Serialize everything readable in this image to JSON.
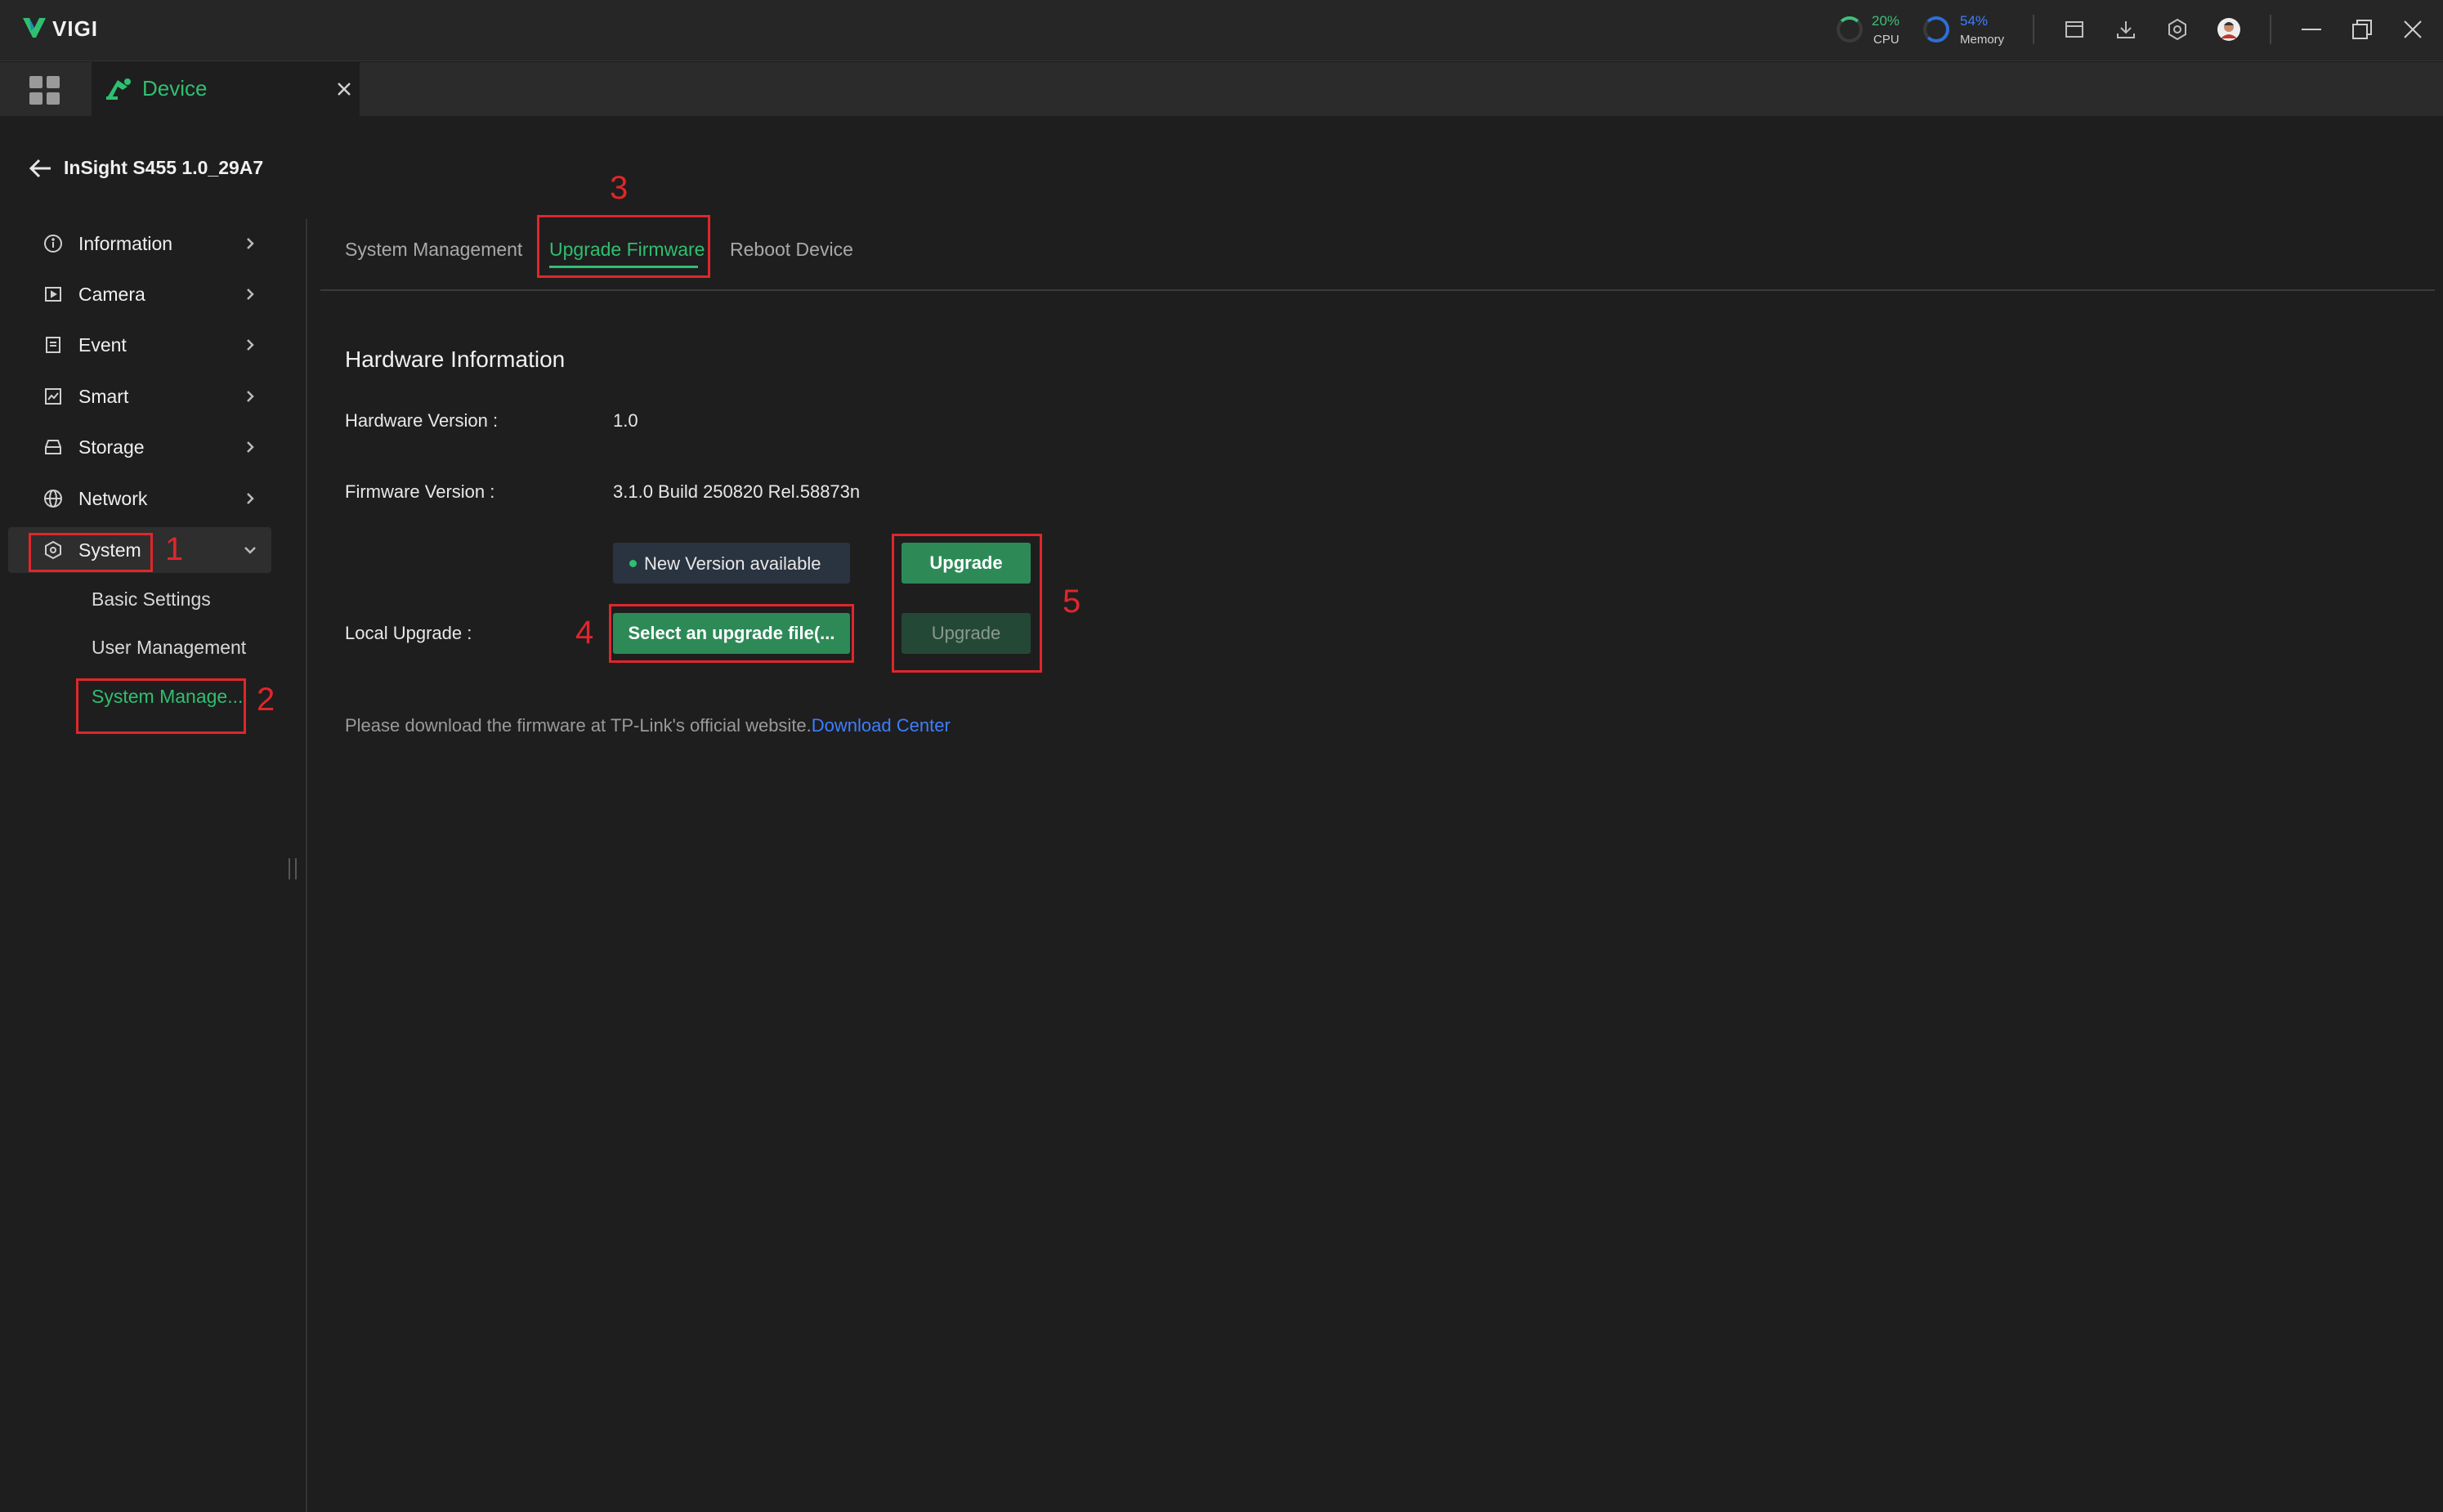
{
  "app": {
    "name": "VIGI"
  },
  "stats": {
    "cpu": {
      "value": "20%",
      "label": "CPU"
    },
    "memory": {
      "value": "54%",
      "label": "Memory"
    }
  },
  "tabs": [
    {
      "label": "Device"
    }
  ],
  "device": {
    "title": "InSight S455 1.0_29A7"
  },
  "sidebar": {
    "items": [
      {
        "label": "Information",
        "icon": "info-icon"
      },
      {
        "label": "Camera",
        "icon": "camera-icon"
      },
      {
        "label": "Event",
        "icon": "event-icon"
      },
      {
        "label": "Smart",
        "icon": "smart-icon"
      },
      {
        "label": "Storage",
        "icon": "storage-icon"
      },
      {
        "label": "Network",
        "icon": "network-icon"
      },
      {
        "label": "System",
        "icon": "system-icon"
      }
    ],
    "sub_items": [
      {
        "label": "Basic Settings"
      },
      {
        "label": "User Management"
      },
      {
        "label": "System Manage..."
      }
    ]
  },
  "content_tabs": [
    {
      "label": "System Management"
    },
    {
      "label": "Upgrade Firmware"
    },
    {
      "label": "Reboot Device"
    }
  ],
  "hardware": {
    "heading": "Hardware Information",
    "hardware_version_label": "Hardware Version :",
    "hardware_version_value": "1.0",
    "firmware_version_label": "Firmware Version :",
    "firmware_version_value": "3.1.0 Build 250820 Rel.58873n",
    "new_version_badge": "New Version available",
    "upgrade_button": "Upgrade",
    "local_upgrade_label": "Local Upgrade :",
    "select_file_button": "Select an upgrade file(...",
    "local_upgrade_button": "Upgrade",
    "note_text": "Please download the firmware at TP-Link's official website.",
    "download_link": "Download Center"
  },
  "annotations": [
    "1",
    "2",
    "3",
    "4",
    "5"
  ],
  "colors": {
    "accent": "#2fbf71",
    "button": "#2d8a57",
    "link": "#3d7eff",
    "annotation": "#e0262b"
  }
}
